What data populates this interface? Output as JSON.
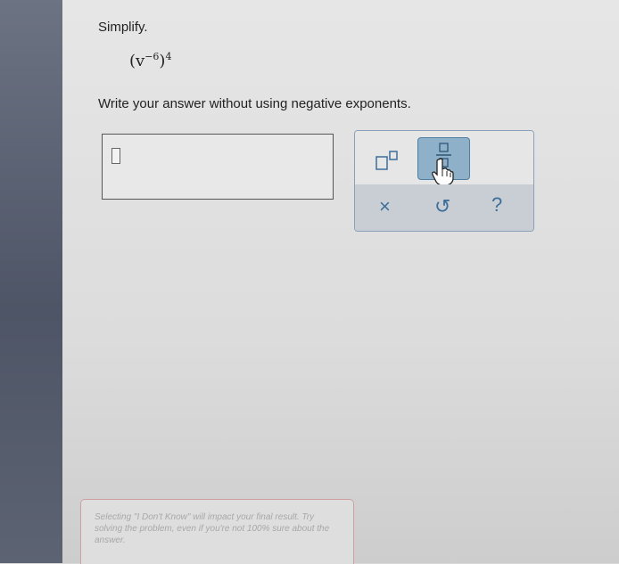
{
  "problem": {
    "title": "Simplify.",
    "expression": {
      "base": "v",
      "inner_exponent": "−6",
      "outer_exponent": "4"
    },
    "instruction": "Write your answer without using negative exponents."
  },
  "toolbar": {
    "exponent_icon": "superscript-icon",
    "fraction_icon": "fraction-icon",
    "clear_label": "×",
    "undo_label": "↺",
    "help_label": "?"
  },
  "note": {
    "text": "Selecting \"I Don't Know\" will impact your final result. Try solving the problem, even if you're not 100% sure about the answer."
  }
}
